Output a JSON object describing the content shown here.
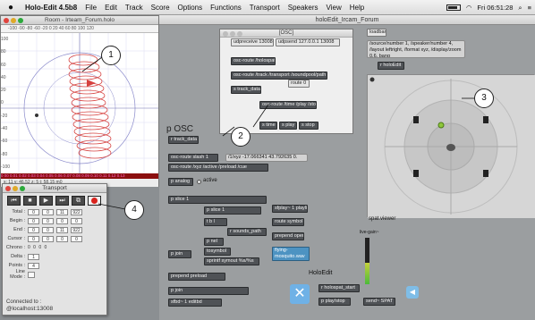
{
  "menubar": {
    "app_name": "Holo-Edit 4.5b8",
    "items": [
      "File",
      "Edit",
      "Track",
      "Score",
      "Options",
      "Functions",
      "Transport",
      "Speakers",
      "View",
      "Help"
    ],
    "clock": "Fri 06:51:28"
  },
  "room": {
    "title": "Room - Irteam_Forum.holo",
    "ruler": "-100 -90 -80 -60 -20 0   20   40   60   80  100  120",
    "y_ticks": [
      "100",
      "80",
      "60",
      "40",
      "20",
      "0",
      "-20",
      "-40",
      "-60",
      "-80",
      "-100"
    ],
    "stripe_text": "0 00 0.01 0.02 0.03 0.04 0.05 0.06 0.07 0.08 0.09 0.10 0.11 0.12 0.13",
    "status": "x: 11 y: 46.52  z: 5  t: 58.15  m0"
  },
  "transport": {
    "title": "Transport",
    "buttons": [
      "⏮",
      "■",
      "▶",
      "⏭",
      "⧉"
    ],
    "rows": [
      {
        "label": "Total :",
        "values": [
          "0",
          "0",
          "11",
          "922"
        ]
      },
      {
        "label": "Begin :",
        "values": [
          "0",
          "0",
          "0",
          "0"
        ]
      },
      {
        "label": "End :",
        "values": [
          "0",
          "0",
          "11",
          "922"
        ]
      },
      {
        "label": "Cursor :",
        "values": [
          "0",
          "0",
          "0",
          "0"
        ]
      },
      {
        "label": "Chrono :",
        "text": "0  0  0  0"
      },
      {
        "label": "Delta :",
        "values": [
          "1"
        ]
      },
      {
        "label": "Points :",
        "values": [
          "4"
        ]
      },
      {
        "label": "Line Mode :",
        "values": [
          ""
        ]
      }
    ],
    "connected_label": "Connected to :",
    "connected_host": "@localhost:13008"
  },
  "patcher": {
    "title": "holoEdit_Ircam_Forum",
    "osc_title": "[OSC]",
    "big_comment": "p OSC",
    "holoedit_label": "HoloEdit",
    "objects": {
      "udpreceive": "udpreceive 13008",
      "udpsend": "udpsend 127.0.0.1 13008",
      "route_holospat": "osc-route /holospat",
      "route_track": "osc-route /track /transport /soundpool/path",
      "route_0": "route 0",
      "s_track_data": "s track_data",
      "route_time": "osc-route /time /play /stop",
      "s_time": "s time",
      "s_play": "s play",
      "s_stop": "s stop",
      "r_track_data": "r track_data",
      "route_slash1": "osc-route slash 1",
      "xyz_msg": "/1/xyz -17.066341 43.792635 0.",
      "route_xyz": "osc-route /xyz /active /preload /cue",
      "p_analog": "p analog",
      "active": "active",
      "p_slice1": "p slice 1",
      "p_slice1b": "p slice 1",
      "t_b": "t b l",
      "r_sounds_path": "r sounds_path",
      "p_nel": "p nel",
      "tosymbol": "tosymbol",
      "sprintf": "sprintf symout %s/%s",
      "p_join": "p join",
      "sfplay": "sfplay~ 1 playlist",
      "route_symbol": "route symbol",
      "prepend_open": "prepend open",
      "flying_wav": "flying-mosquito.wav",
      "prepend_preload": "prepend preload",
      "p_join2": "p join",
      "sfbd": "sfbd~ 1 editbd",
      "loadbang": "loadbang",
      "msg_source": "/source/number 1, /speaker/number 4, /layout leftright, /format xyz, /display/zoom 0.6, bang",
      "r_holoedit": "r holoEdit",
      "spat_viewer": "spat.viewer",
      "gain_label": "live-gain~",
      "r_holospat_start": "r holospat_start",
      "p_play_stop": "p play/stop",
      "send_spat": "send~ SPAT"
    }
  },
  "callouts": [
    "1",
    "2",
    "3",
    "4"
  ],
  "colors": {
    "trajectory": "#d6413f",
    "speaker_green": "#8ec73a",
    "record": "#d9231d",
    "object_dark": "#4f5256",
    "accent_blue": "#4d93c2"
  }
}
